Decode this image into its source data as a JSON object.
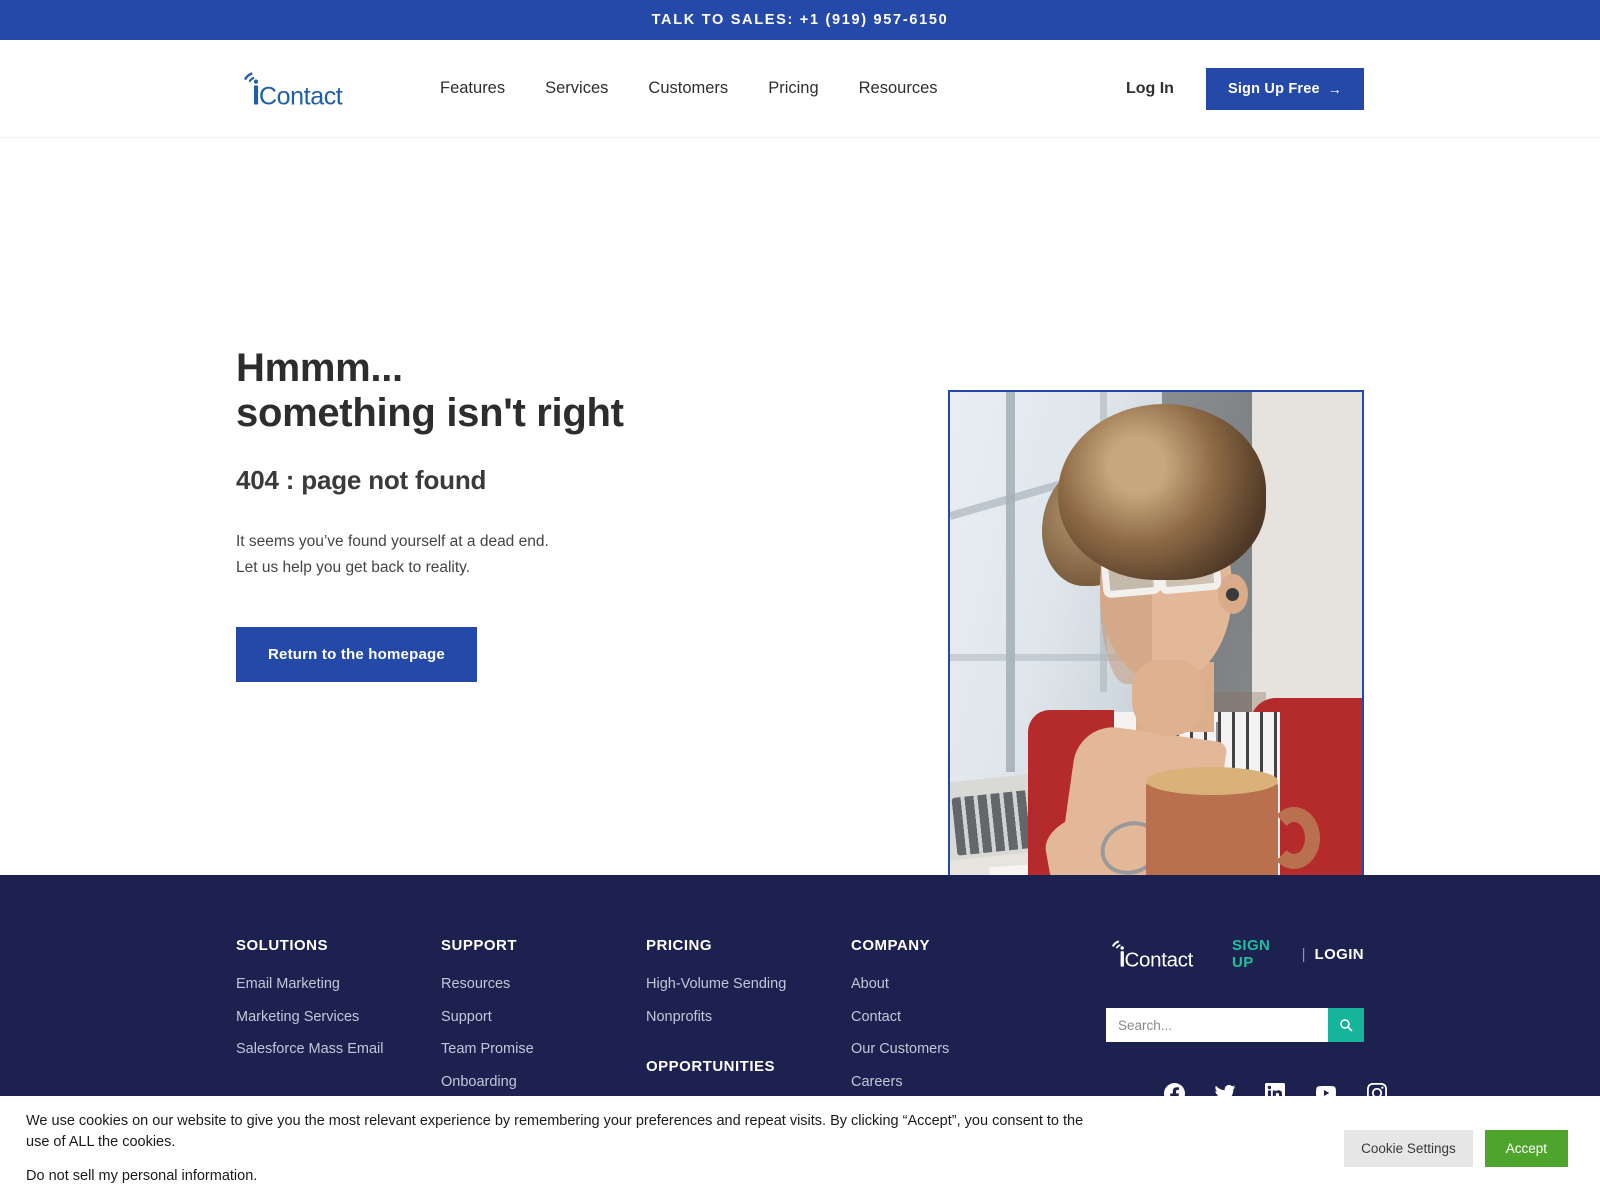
{
  "salesbar": {
    "text": "TALK TO SALES: +1 (919) 957-6150"
  },
  "brand": {
    "name": "iContact",
    "primary_color": "#2449a8",
    "footer_bg": "#1c2150",
    "teal": "#16b49a"
  },
  "header": {
    "logo_alt": "iContact",
    "nav": [
      {
        "label": "Features"
      },
      {
        "label": "Services"
      },
      {
        "label": "Customers"
      },
      {
        "label": "Pricing"
      },
      {
        "label": "Resources"
      }
    ],
    "login_label": "Log In",
    "signup_label": "Sign Up Free",
    "signup_arrow": "→"
  },
  "hero": {
    "heading_line1": "Hmmm...",
    "heading_line2": "something isn't right",
    "subheading": "404 : page not found",
    "body_line1": "It seems you’ve found yourself at a dead end.",
    "body_line2": "Let us help you get back to reality.",
    "cta_label": "Return to the homepage",
    "image_alt": "Person with curly hair and white glasses in red cardigan thinking at a laptop with a coffee mug"
  },
  "footer": {
    "columns": [
      {
        "title": "SOLUTIONS",
        "links": [
          "Email Marketing",
          "Marketing Services",
          "Salesforce Mass Email"
        ]
      },
      {
        "title": "SUPPORT",
        "links": [
          "Resources",
          "Support",
          "Team Promise",
          "Onboarding"
        ]
      },
      {
        "title": "PRICING",
        "links": [
          "High-Volume Sending",
          "Nonprofits"
        ],
        "title2": "OPPORTUNITIES"
      },
      {
        "title": "COMPANY",
        "links": [
          "About",
          "Contact",
          "Our Customers",
          "Careers"
        ]
      }
    ],
    "logo_alt": "iContact",
    "signup_label": "SIGN UP",
    "separator": "|",
    "login_label": "LOGIN",
    "search_placeholder": "Search...",
    "search_value": "",
    "search_icon": "search-icon",
    "socials": [
      {
        "name": "facebook-icon"
      },
      {
        "name": "twitter-icon"
      },
      {
        "name": "linkedin-icon"
      },
      {
        "name": "youtube-icon"
      },
      {
        "name": "instagram-icon"
      }
    ]
  },
  "cookie": {
    "body": "We use cookies on our website to give you the most relevant experience by remembering your preferences and repeat visits. By clicking “Accept”, you consent to the use of ALL the cookies.",
    "optout_label": "Do not sell my personal information.",
    "settings_label": "Cookie Settings",
    "accept_label": "Accept"
  }
}
